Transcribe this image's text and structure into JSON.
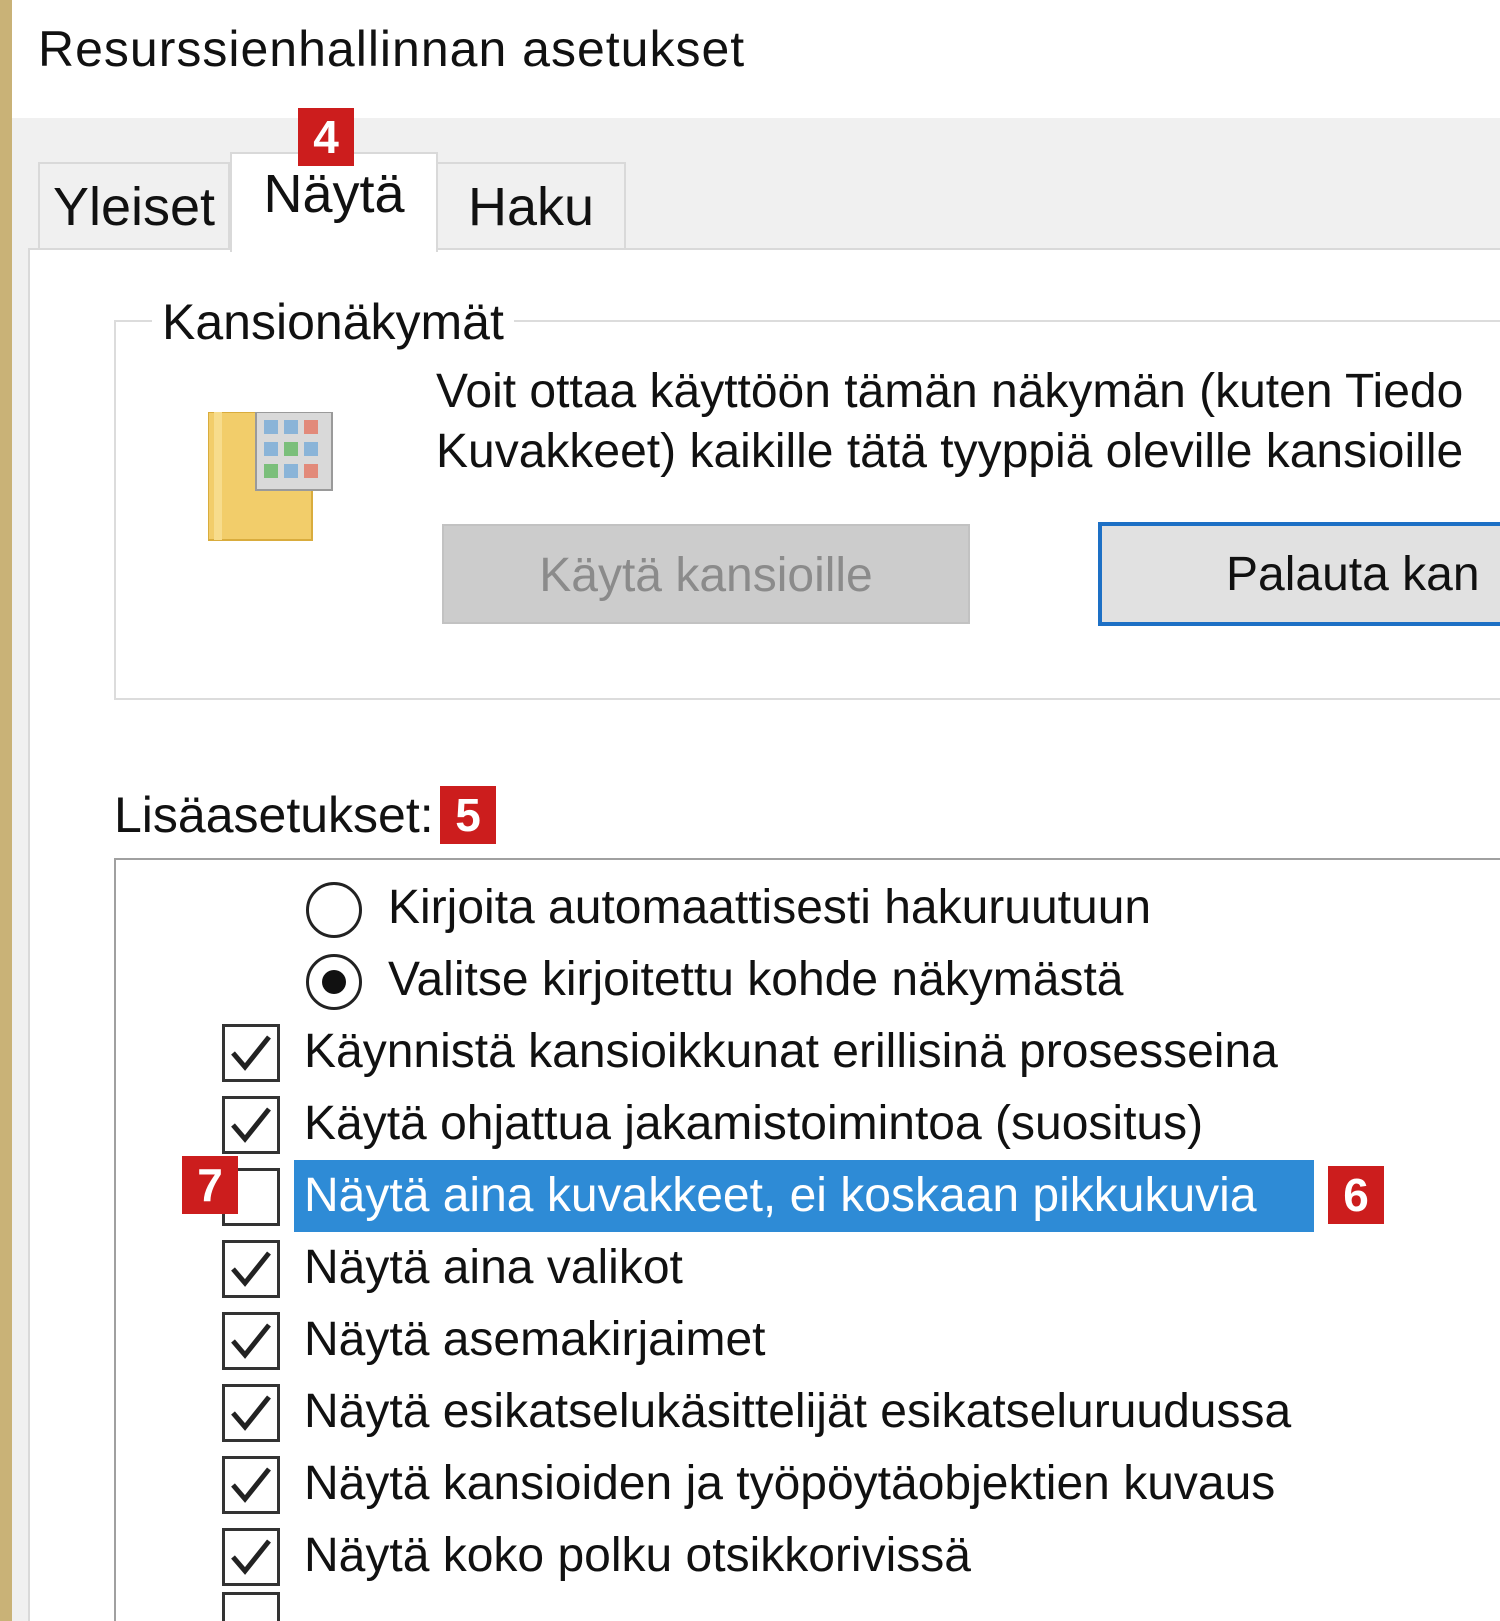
{
  "window": {
    "title": "Resurssienhallinnan asetukset"
  },
  "tabs": [
    {
      "label": "Yleiset",
      "active": false
    },
    {
      "label": "Näytä",
      "active": true
    },
    {
      "label": "Haku",
      "active": false
    }
  ],
  "folder_views": {
    "legend": "Kansionäkymät",
    "description_line1": "Voit ottaa käyttöön tämän näkymän (kuten Tiedo",
    "description_line2": "Kuvakkeet) kaikille tätä tyyppiä oleville kansioille",
    "apply_button": "Käytä kansioille",
    "reset_button": "Palauta kan"
  },
  "advanced": {
    "label": "Lisäasetukset:",
    "items": [
      {
        "type": "radio",
        "label": "Kirjoita automaattisesti hakuruutuun",
        "checked": false
      },
      {
        "type": "radio",
        "label": "Valitse kirjoitettu kohde näkymästä",
        "checked": true
      },
      {
        "type": "checkbox",
        "label": "Käynnistä kansioikkunat erillisinä prosesseina",
        "checked": true
      },
      {
        "type": "checkbox",
        "label": "Käytä ohjattua jakamistoimintoa (suositus)",
        "checked": true
      },
      {
        "type": "checkbox",
        "label": "Näytä aina kuvakkeet, ei koskaan pikkukuvia",
        "checked": false,
        "selected": true
      },
      {
        "type": "checkbox",
        "label": "Näytä aina valikot",
        "checked": true
      },
      {
        "type": "checkbox",
        "label": "Näytä asemakirjaimet",
        "checked": true
      },
      {
        "type": "checkbox",
        "label": "Näytä esikatselukäsittelijät esikatseluruudussa",
        "checked": true
      },
      {
        "type": "checkbox",
        "label": "Näytä kansioiden ja työpöytäobjektien kuvaus",
        "checked": true
      },
      {
        "type": "checkbox",
        "label": "Näytä koko polku otsikkorivissä",
        "checked": true
      }
    ]
  },
  "markers": {
    "m4": "4",
    "m5": "5",
    "m6": "6",
    "m7": "7"
  },
  "colors": {
    "selection": "#2e8bd6",
    "marker": "#cc1d1d",
    "focus_border": "#1d70c5"
  }
}
